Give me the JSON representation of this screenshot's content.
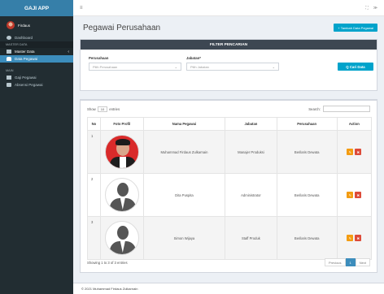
{
  "app": {
    "brand": "GAJI APP"
  },
  "user": {
    "name": "Firdaus"
  },
  "sidebar": {
    "items": [
      {
        "label": "Dashboard",
        "icon": "dashboard-icon"
      }
    ],
    "master_header": "MASTER DATA",
    "master": {
      "label": "Master Data",
      "caret": "‹"
    },
    "master_children": [
      {
        "label": "Data Pegawai"
      }
    ],
    "main_header": "MAIN",
    "main_items": [
      {
        "label": "Gaji Pegawai"
      },
      {
        "label": "Absensi Pegawai"
      }
    ]
  },
  "topbar": {
    "menu_icon": "≡",
    "right_icons": [
      "⛶",
      "≫"
    ]
  },
  "page": {
    "title": "Pegawai Perusahaan",
    "add_button": "+ Tambah Data Pegawai"
  },
  "filter": {
    "header": "FILTER PENCARIAN",
    "perusahaan_label": "Perusahaan",
    "perusahaan_placeholder": "Pilih Perusahaan",
    "jabatan_label": "Jabatan*",
    "jabatan_placeholder": "Pilih Jabatan",
    "search_button": "Q Cari Data"
  },
  "table": {
    "show_label": "Show",
    "entries_value": "10",
    "entries_label": "entries",
    "search_label": "Search:",
    "headers": [
      "No",
      "Foto Profil",
      "Nama Pegawai",
      "Jabatan",
      "Perusahaan",
      "Action"
    ],
    "rows": [
      {
        "no": "1",
        "name": "Muhammad Firdaus Zulkarnain",
        "jabatan": "Manajer Produksi",
        "perusahaan": "Berilaris Dewata"
      },
      {
        "no": "2",
        "name": "Dita Puspita",
        "jabatan": "Administrator",
        "perusahaan": "Berilaris Dewata"
      },
      {
        "no": "3",
        "name": "Simon Wijaya",
        "jabatan": "Staff Produk",
        "perusahaan": "Berilaris Dewata"
      }
    ],
    "info": "Showing 1 to 3 of 3 entries",
    "pagination": {
      "previous": "Previous",
      "current": "1",
      "next": "Next"
    }
  },
  "footer": {
    "text": "© 2021 Muhammad Firdaus Zulkarnain"
  },
  "colors": {
    "sidebar": "#222d32",
    "brand": "#367fa9",
    "accent": "#00a3cb",
    "edit": "#f39c12",
    "delete": "#dd4b39"
  }
}
